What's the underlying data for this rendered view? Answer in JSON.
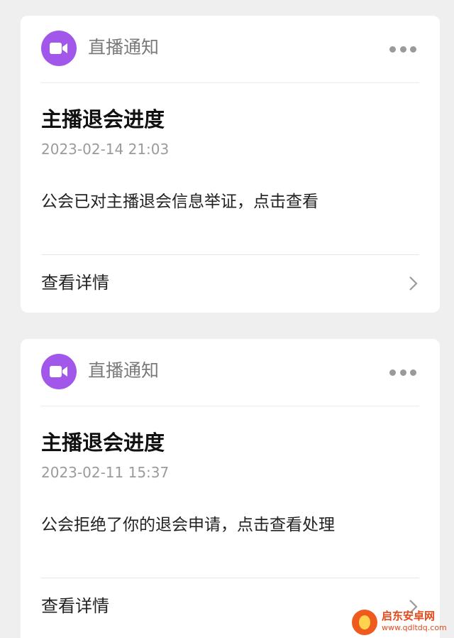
{
  "colors": {
    "background": "#efefef",
    "card": "#ffffff",
    "app_icon": "#a158ea",
    "watermark": "#e24a1a"
  },
  "notifications": [
    {
      "source": "直播通知",
      "source_icon": "video-camera-icon",
      "title": "主播退会进度",
      "time": "2023-02-14 21:03",
      "message": "公会已对主播退会信息举证，点击查看",
      "action_label": "查看详情"
    },
    {
      "source": "直播通知",
      "source_icon": "video-camera-icon",
      "title": "主播退会进度",
      "time": "2023-02-11 15:37",
      "message": "公会拒绝了你的退会申请，点击查看处理",
      "action_label": "查看详情"
    }
  ],
  "watermark": {
    "name": "启东安卓网",
    "url": "www.qdltdq.com"
  }
}
